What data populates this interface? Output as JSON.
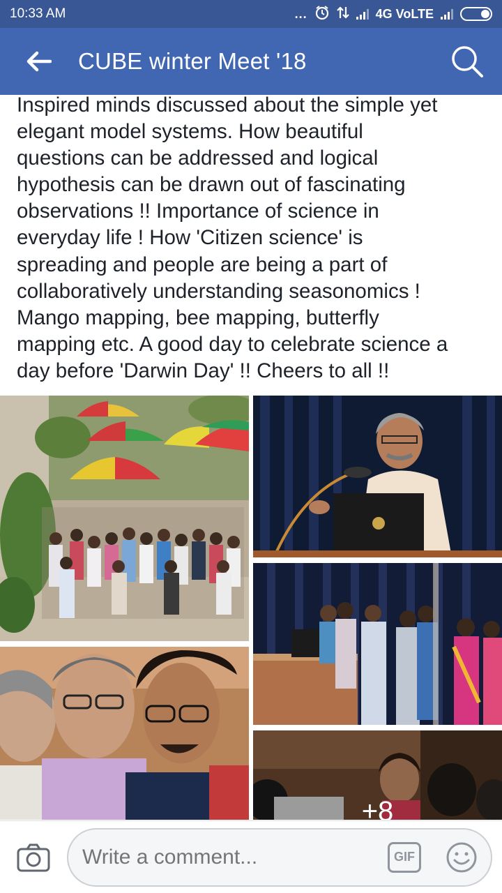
{
  "status_bar": {
    "time": "10:33 AM",
    "dots": "...",
    "network": "4G VoLTE"
  },
  "header": {
    "title": "CUBE winter Meet '18"
  },
  "post": {
    "text": "Inspired minds discussed about the simple yet\nelegant model systems. How beautiful\nquestions can be addressed and logical\nhypothesis can be drawn out of fascinating\nobservations !! Importance of science in\neveryday life ! How 'Citizen science' is\nspreading and people are being a part of\ncollaboratively understanding seasonomics !\nMango mapping, bee mapping, butterfly\nmapping etc. A good day to celebrate science a\nday before 'Darwin Day' !! Cheers to all !!"
  },
  "photos": {
    "more_count": "+8"
  },
  "comment_bar": {
    "placeholder": "Write a comment...",
    "gif_label": "GIF"
  },
  "colors": {
    "status_bar": "#3a5795",
    "app_bar": "#4267b2",
    "text": "#1d2129",
    "muted": "#90949c"
  }
}
